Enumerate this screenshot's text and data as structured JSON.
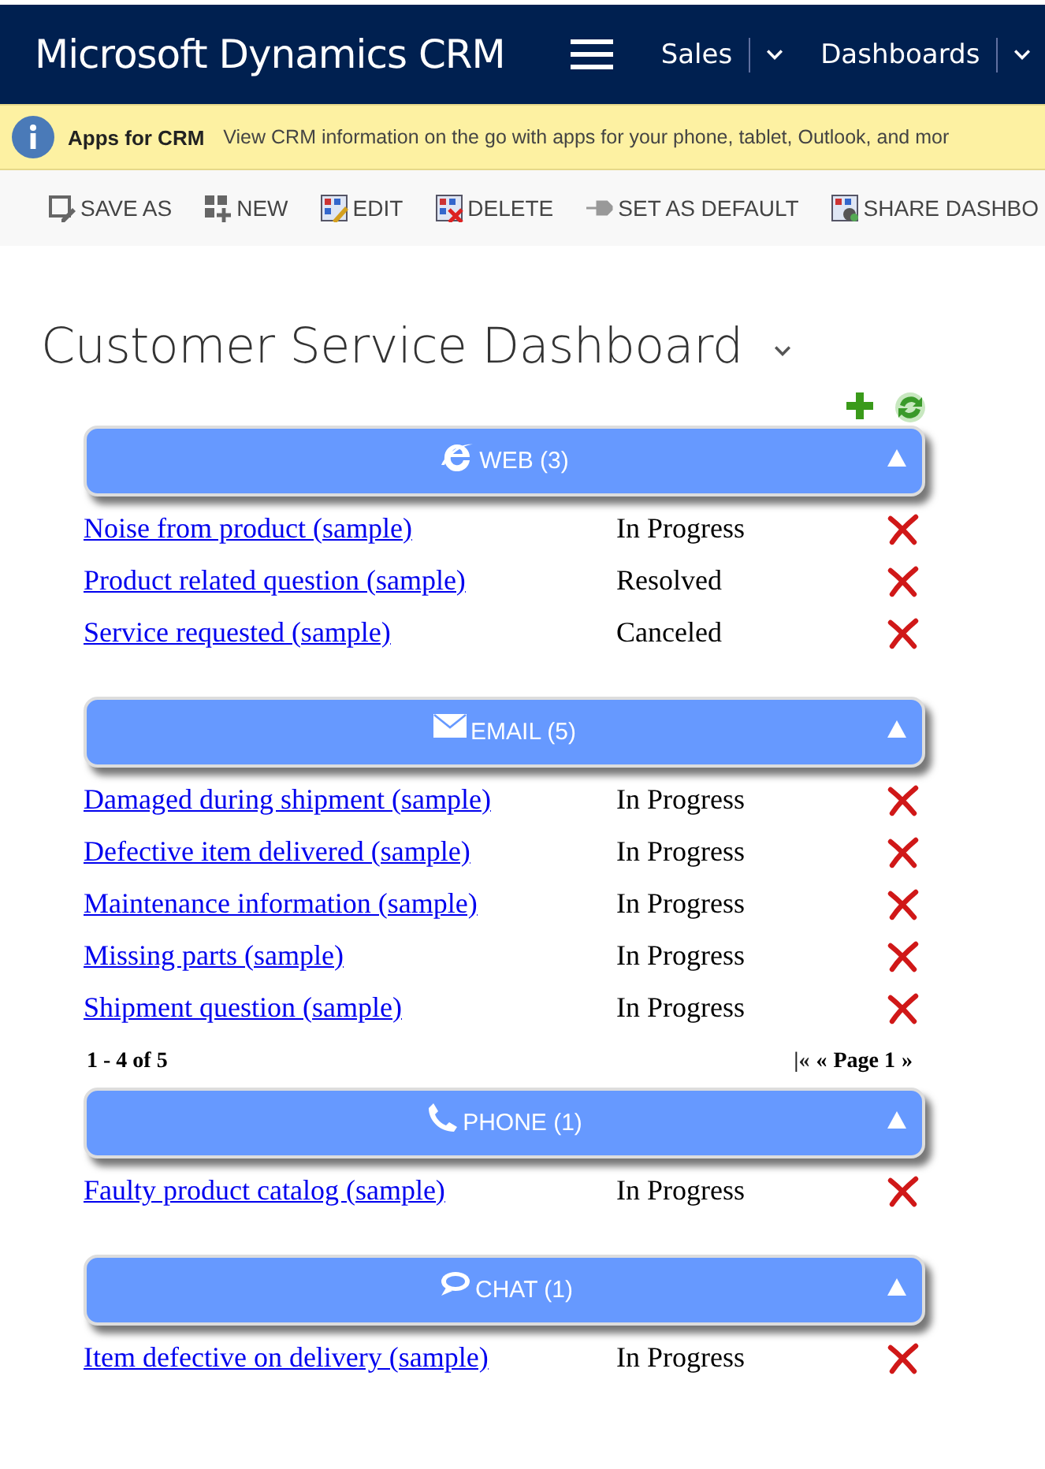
{
  "top_bar": {
    "product": "Microsoft Dynamics CRM",
    "nav": [
      {
        "label": "Sales"
      },
      {
        "label": "Dashboards"
      }
    ]
  },
  "notification": {
    "title": "Apps for CRM",
    "message": "View CRM information on the go with apps for your phone, tablet, Outlook, and mor"
  },
  "toolbar": [
    {
      "label": "SAVE AS",
      "kind": "saveas"
    },
    {
      "label": "NEW",
      "kind": "new"
    },
    {
      "label": "EDIT",
      "kind": "edit"
    },
    {
      "label": "DELETE",
      "kind": "delete"
    },
    {
      "label": "SET AS DEFAULT",
      "kind": "pin"
    },
    {
      "label": "SHARE DASHBO",
      "kind": "share"
    }
  ],
  "dashboard": {
    "title": "Customer Service Dashboard"
  },
  "sections": [
    {
      "kind": "web",
      "title": "WEB (3)",
      "expanded": true,
      "rows": [
        {
          "case": "Noise from product (sample)",
          "status": "In Progress"
        },
        {
          "case": "Product related question (sample)",
          "status": "Resolved"
        },
        {
          "case": "Service requested (sample)",
          "status": "Canceled"
        }
      ]
    },
    {
      "kind": "email",
      "title": "EMAIL (5)",
      "expanded": true,
      "rows": [
        {
          "case": "Damaged during shipment (sample)",
          "status": "In Progress"
        },
        {
          "case": "Defective item delivered (sample)",
          "status": "In Progress"
        },
        {
          "case": "Maintenance information (sample)",
          "status": "In Progress"
        },
        {
          "case": "Missing parts (sample)",
          "status": "In Progress"
        },
        {
          "case": "Shipment question (sample)",
          "status": "In Progress"
        }
      ],
      "pager": {
        "range": "1 - 4 of 5",
        "first": "|«",
        "prev": "«",
        "page": "Page 1",
        "next": "»"
      }
    },
    {
      "kind": "phone",
      "title": "PHONE (1)",
      "expanded": true,
      "rows": [
        {
          "case": "Faulty product catalog (sample)",
          "status": "In Progress"
        }
      ]
    },
    {
      "kind": "chat",
      "title": "CHAT (1)",
      "expanded": true,
      "rows": [
        {
          "case": "Item defective on delivery (sample)",
          "status": "In Progress"
        }
      ]
    }
  ]
}
